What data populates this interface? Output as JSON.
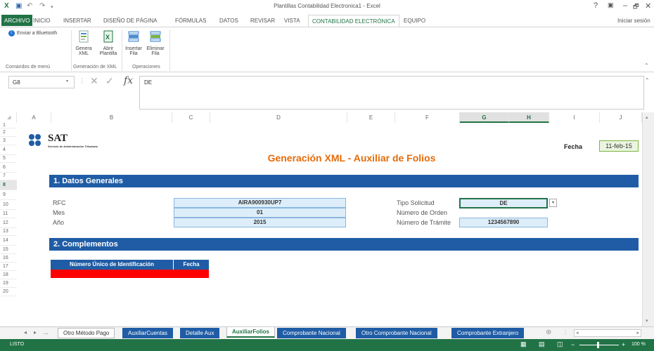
{
  "window": {
    "title": "Plantillas Contabilidad Electronica1 - Excel",
    "help": "?",
    "minimize": "–",
    "restore": "🗗",
    "close": "✕",
    "sign_in": "Iniciar sesión"
  },
  "ribbon_tabs": [
    "ARCHIVO",
    "INICIO",
    "INSERTAR",
    "DISEÑO DE PÁGINA",
    "FÓRMULAS",
    "DATOS",
    "REVISAR",
    "VISTA",
    "CONTABILIDAD ELECTRÓNICA",
    "EQUIPO"
  ],
  "ribbon": {
    "bluetooth": "Enviar a Bluetooth",
    "group_menu": "Comandos de menú",
    "genera_1": "Genera",
    "genera_2": "XML",
    "abrir_1": "Abrir",
    "abrir_2": "Plantilla",
    "group_xml": "Generación de XML",
    "insertar_1": "Insertar",
    "insertar_2": "Fila",
    "eliminar_1": "Eliminar",
    "eliminar_2": "Fila",
    "group_ops": "Operaciones"
  },
  "formula_bar": {
    "name_box": "G8",
    "fx": "fx",
    "content": "DE"
  },
  "columns": [
    "A",
    "B",
    "C",
    "D",
    "E",
    "F",
    "G",
    "H",
    "I",
    "J"
  ],
  "rows": [
    "1",
    "2",
    "3",
    "4",
    "5",
    "6",
    "7",
    "8",
    "9",
    "10",
    "11",
    "12",
    "13",
    "14",
    "15",
    "16",
    "17",
    "18",
    "19",
    "20"
  ],
  "sheet": {
    "logo_text": "SAT",
    "logo_sub": "Servicio de Administración Tributaria",
    "fecha_label": "Fecha",
    "fecha_value": "11-feb-15",
    "title": "Generación XML - Auxiliar de Folios",
    "section1": "1. Datos Generales",
    "rfc_label": "RFC",
    "rfc_value": "AIRA900930UP7",
    "mes_label": "Mes",
    "mes_value": "01",
    "anio_label": "Año",
    "anio_value": "2015",
    "tipo_label": "Tipo Solicitud",
    "tipo_value": "DE",
    "orden_label": "Número de Orden",
    "tramite_label": "Número de Trámite",
    "tramite_value": "1234567890",
    "section2": "2. Complementos",
    "th_numero": "Número Único de Identificación",
    "th_fecha": "Fecha"
  },
  "sheet_tabs": [
    "...",
    "Otro Método Pago",
    "AuxiliarCuentas",
    "Detalle Aux",
    "AuxiliarFolios",
    "Comprobante Nacional",
    "Otro Comprobante Nacional",
    "Comprobante Extranjero"
  ],
  "status": {
    "ready": "LISTO",
    "zoom": "100 %"
  },
  "colors": {
    "excel_green": "#217346",
    "section_blue": "#1f5ca5",
    "title_orange": "#e46c0a",
    "input_blue": "#ddeefa",
    "red_row": "#ff0000"
  }
}
